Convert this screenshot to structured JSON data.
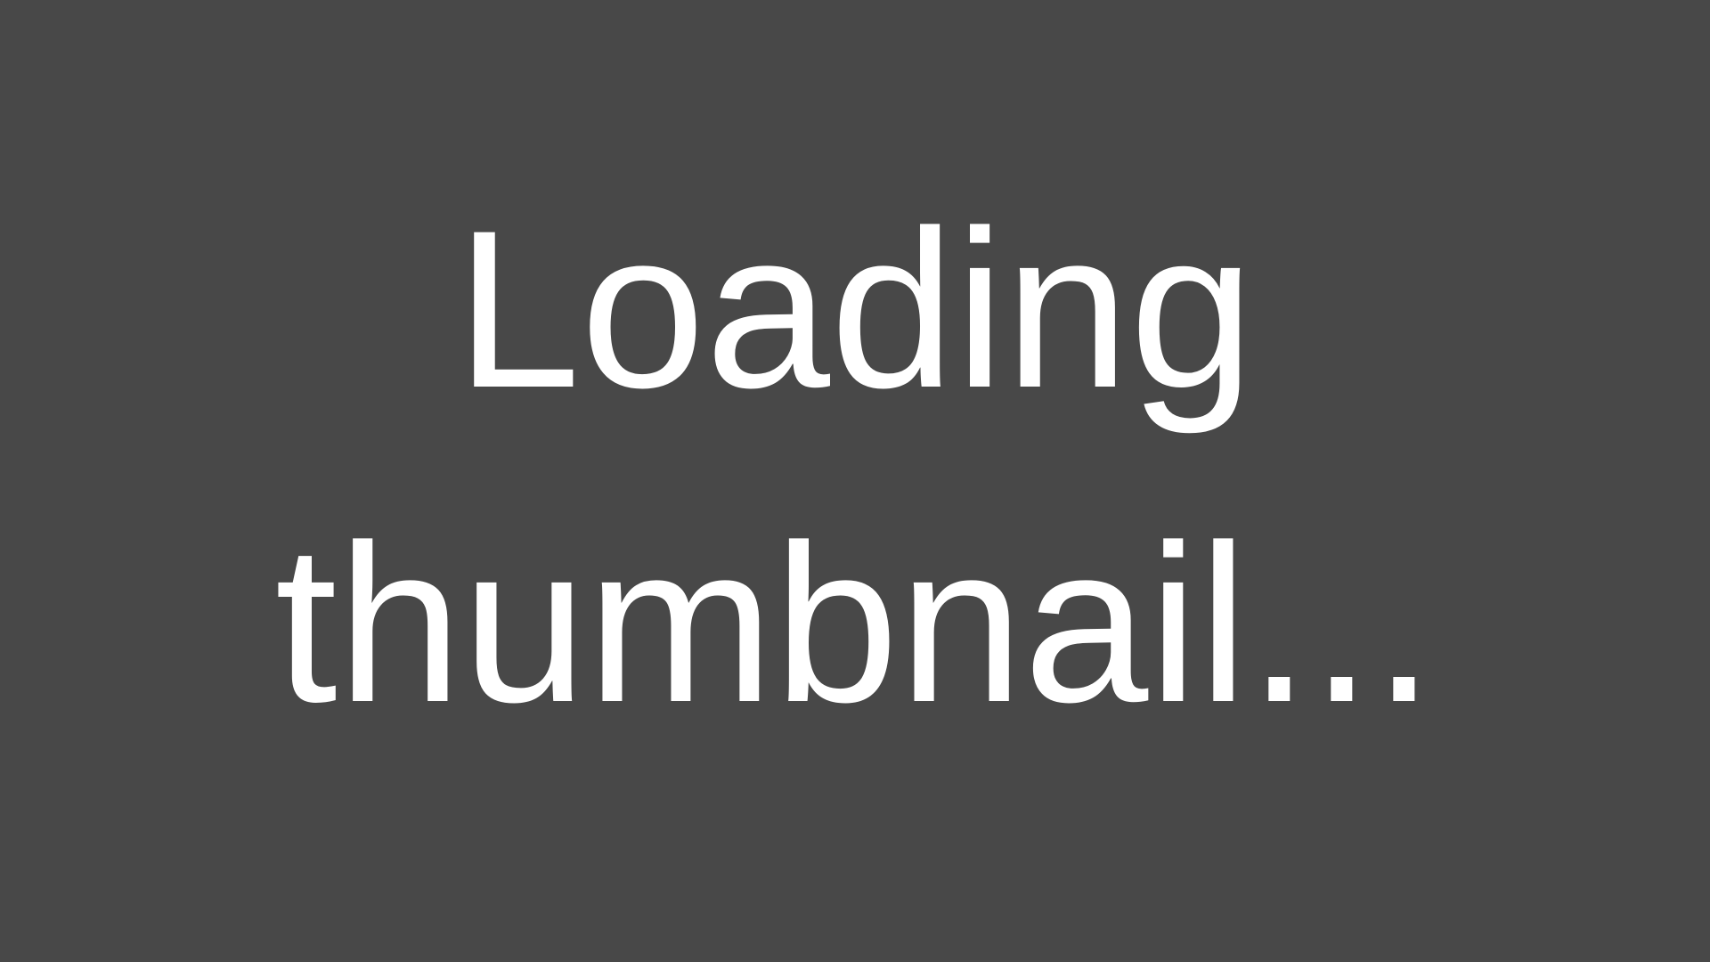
{
  "placeholder": {
    "background_color": "#484848",
    "text_color": "#ffffff",
    "message_lines": [
      "Loading",
      "thumbnail..."
    ]
  }
}
